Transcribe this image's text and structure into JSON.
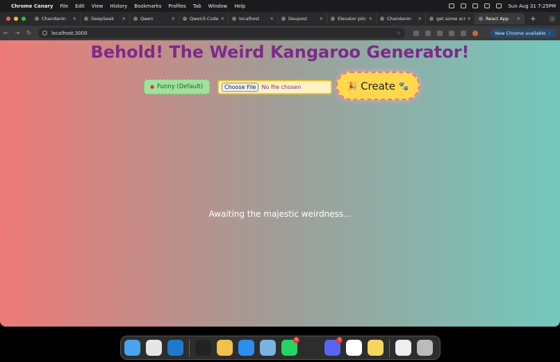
{
  "menubar": {
    "app": "Chrome Canary",
    "items": [
      "File",
      "Edit",
      "View",
      "History",
      "Bookmarks",
      "Profiles",
      "Tab",
      "Window",
      "Help"
    ],
    "datetime": "Sun Aug 31  7:25PM"
  },
  "tabs": [
    {
      "label": "ChandanIn"
    },
    {
      "label": "DeepSeek"
    },
    {
      "label": "Qwen"
    },
    {
      "label": "Qwen3-Code"
    },
    {
      "label": "localhost"
    },
    {
      "label": "Devpost"
    },
    {
      "label": "Elevator pitc"
    },
    {
      "label": "ChandanIn"
    },
    {
      "label": "get some scr"
    },
    {
      "label": "React App",
      "active": true
    }
  ],
  "toolbar": {
    "url": "localhost:3000",
    "new_chrome": "New Chrome available"
  },
  "page": {
    "title": "Behold! The Weird Kangaroo Generator!",
    "style_select": "Funny (Default)",
    "file_button": "Choose File",
    "file_status": "No file chosen",
    "create_label": "Create",
    "status": "Awaiting the majestic weirdness..."
  },
  "colors": {
    "gradient_left": "#ee7a78",
    "gradient_right": "#73c8bd",
    "title": "#7d2a8a",
    "create_bg": "#ffd84e",
    "select_bg": "#9ee29c"
  },
  "dock": {
    "icons": [
      {
        "name": "finder-icon",
        "color": "#4aa3ef"
      },
      {
        "name": "launchpad-icon",
        "color": "#e6e6e6"
      },
      {
        "name": "vscode-icon",
        "color": "#1f7acd"
      },
      {
        "name": "terminal-icon",
        "color": "#222222"
      },
      {
        "name": "chrome-canary-icon",
        "color": "#f2c14a"
      },
      {
        "name": "safari-icon",
        "color": "#2b8ef0"
      },
      {
        "name": "preview-icon",
        "color": "#7bb3e0"
      },
      {
        "name": "whatsapp-icon",
        "color": "#25d366",
        "badge": "6"
      },
      {
        "name": "cursor-icon",
        "color": "#2d2d2d"
      },
      {
        "name": "discord-icon",
        "color": "#5865f2",
        "badge": "2"
      },
      {
        "name": "chrome-icon",
        "color": "#ffffff"
      },
      {
        "name": "notes-icon",
        "color": "#f5d65b"
      },
      {
        "name": "document-icon",
        "color": "#eeeeee"
      },
      {
        "name": "trash-icon",
        "color": "#bbbbbb"
      }
    ]
  }
}
